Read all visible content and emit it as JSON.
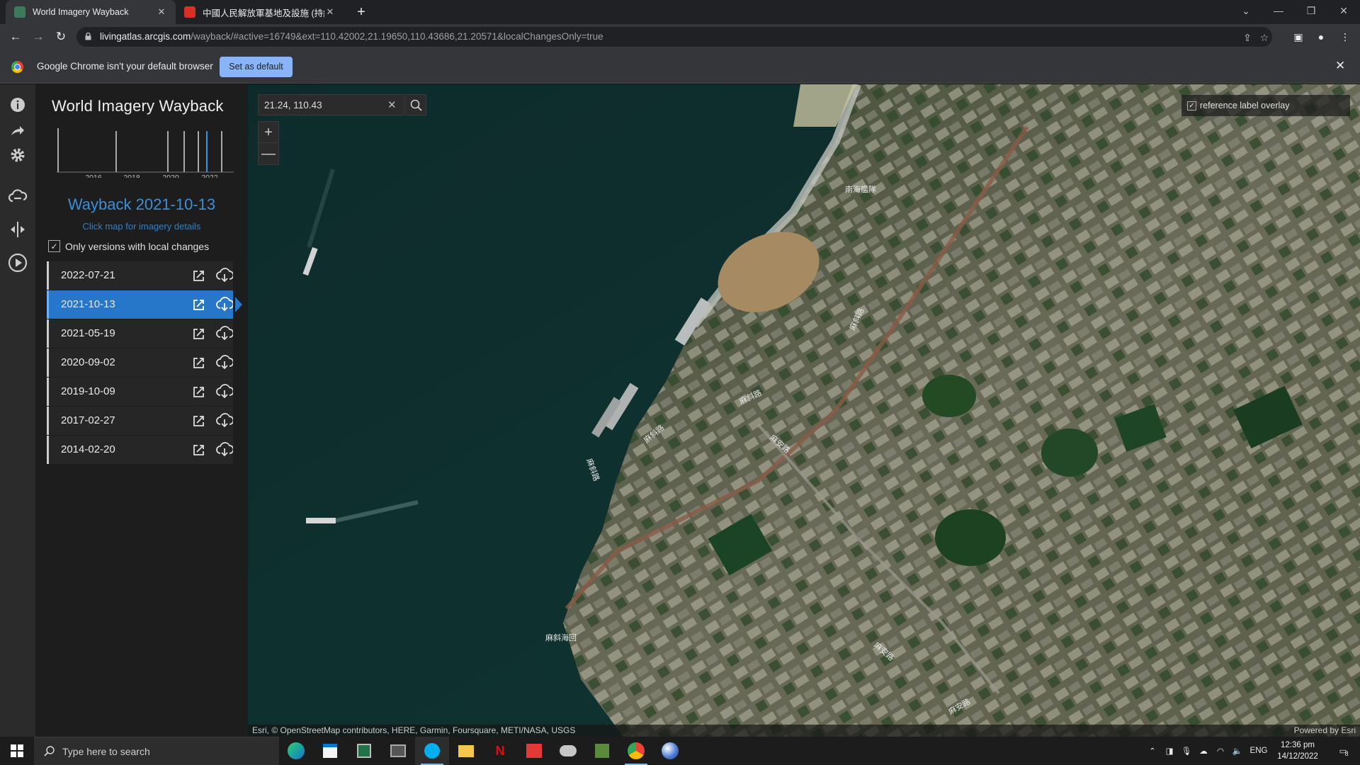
{
  "browser": {
    "tabs": [
      {
        "title": "World Imagery Wayback",
        "active": true
      },
      {
        "title": "中國人民解放軍基地及設施 (持續",
        "active": false
      }
    ],
    "url_host": "livingatlas.arcgis.com",
    "url_path": "/wayback/#active=16749&ext=110.42002,21.19650,110.43686,21.20571&localChangesOnly=true",
    "infobar": {
      "message": "Google Chrome isn't your default browser",
      "button": "Set as default"
    }
  },
  "app": {
    "title": "World Imagery Wayback",
    "timeline_years": [
      "2016",
      "2018",
      "2020",
      "2022"
    ],
    "current_release": "Wayback 2021-10-13",
    "click_hint": "Click map for imagery details",
    "local_changes_label": "Only versions with local changes",
    "local_changes_checked": true,
    "releases": [
      {
        "date": "2022-07-21",
        "active": false
      },
      {
        "date": "2021-10-13",
        "active": true
      },
      {
        "date": "2021-05-19",
        "active": false
      },
      {
        "date": "2020-09-02",
        "active": false
      },
      {
        "date": "2019-10-09",
        "active": false
      },
      {
        "date": "2017-02-27",
        "active": false
      },
      {
        "date": "2014-02-20",
        "active": false
      }
    ]
  },
  "map": {
    "search_value": "21.24, 110.43",
    "zoom_in": "+",
    "zoom_out": "—",
    "reference_overlay_label": "reference label overlay",
    "reference_overlay_checked": true,
    "attribution": "Esri, © OpenStreetMap contributors, HERE, Garmin, Foursquare, METI/NASA, USGS",
    "powered_by": "Powered by Esri",
    "map_labels": [
      "南海艦隊",
      "麻斜路",
      "麻斜路",
      "麻斜路",
      "麻安路",
      "麻斜路",
      "麻斜海回",
      "麻安路",
      "麻安路"
    ]
  },
  "taskbar": {
    "search_placeholder": "Type here to search",
    "lang": "ENG",
    "time": "12:36 pm",
    "date": "14/12/2022",
    "notification_count": "8"
  },
  "colors": {
    "accent_blue": "#2677c9",
    "sea": "#0f2a2a",
    "panel_bg": "#1d1d1d"
  }
}
